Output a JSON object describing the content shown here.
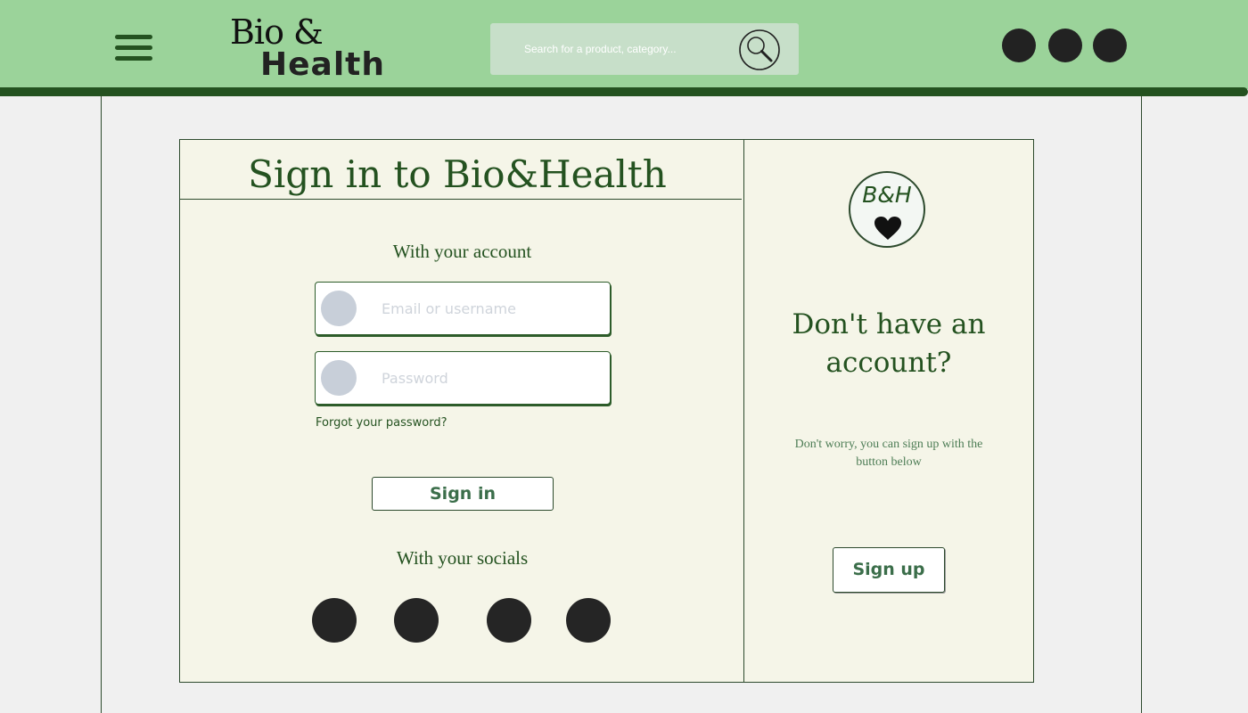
{
  "header": {
    "logo_line1": "Bio &",
    "logo_line2": "Health",
    "search": {
      "placeholder": "Search for a product, category..."
    },
    "action_icons": [
      "circle-icon",
      "circle-icon",
      "circle-icon"
    ]
  },
  "login": {
    "title": "Sign in to Bio&Health",
    "account_heading": "With your account",
    "email_placeholder": "Email or username",
    "password_placeholder": "Password",
    "forgot_label": "Forgot your password?",
    "signin_label": "Sign in",
    "socials_heading": "With your socials",
    "social_icons": [
      "social-icon",
      "social-icon",
      "social-icon",
      "social-icon"
    ]
  },
  "signup": {
    "badge_text": "B&H",
    "heading": "Don't have an account?",
    "note": "Don't worry, you can sign up with the button below",
    "button_label": "Sign up"
  },
  "colors": {
    "header_bg": "#9bd39a",
    "header_bar": "#245220",
    "accent_text": "#245220",
    "panel_bg": "#f5f5e8",
    "page_bg": "#f0f0f0"
  }
}
